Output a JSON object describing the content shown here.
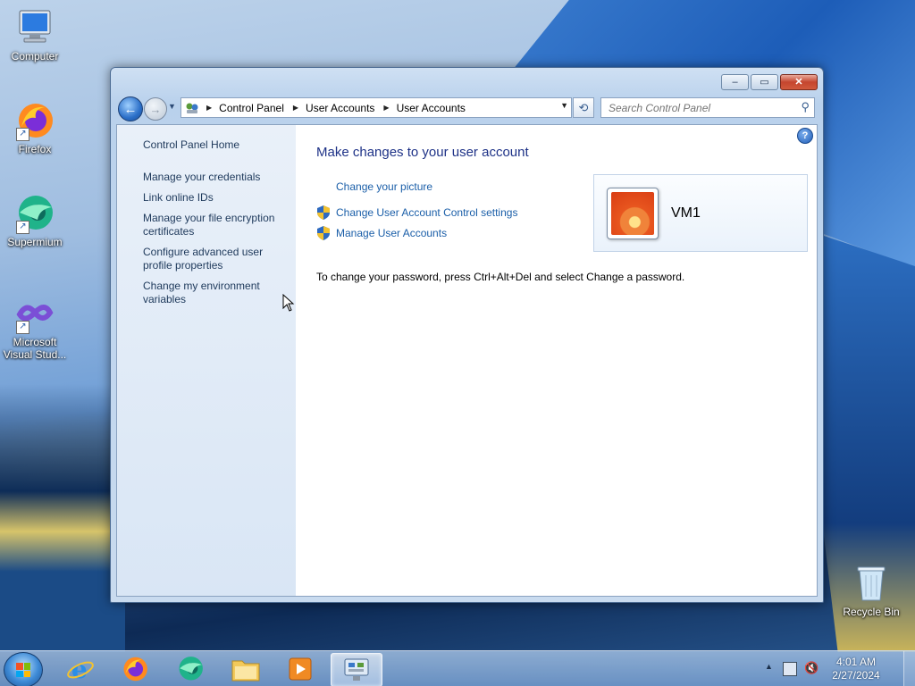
{
  "desktop": {
    "icons": [
      {
        "label": "Computer"
      },
      {
        "label": "Firefox"
      },
      {
        "label": "Supermium"
      },
      {
        "label": "Microsoft Visual Stud..."
      },
      {
        "label": "Recycle Bin"
      }
    ]
  },
  "window": {
    "caption": {
      "minimize": "–",
      "maximize": "▭",
      "close": "✕"
    },
    "breadcrumb": [
      "Control Panel",
      "User Accounts",
      "User Accounts"
    ],
    "search_placeholder": "Search Control Panel"
  },
  "left_pane": {
    "home": "Control Panel Home",
    "tasks": [
      "Manage your credentials",
      "Link online IDs",
      "Manage your file encryption certificates",
      "Configure advanced user profile properties",
      "Change my environment variables"
    ]
  },
  "main": {
    "title": "Make changes to your user account",
    "links": [
      {
        "label": "Change your picture",
        "shield": false
      },
      {
        "label": "Change User Account Control settings",
        "shield": true
      },
      {
        "label": "Manage User Accounts",
        "shield": true
      }
    ],
    "note": "To change your password, press Ctrl+Alt+Del and select Change a password.",
    "user": {
      "name": "VM1"
    }
  },
  "taskbar": {
    "apps": [
      "internet-explorer",
      "firefox",
      "supermium",
      "file-explorer",
      "media-player",
      "control-panel"
    ],
    "active_app": "control-panel",
    "clock": {
      "time": "4:01 AM",
      "date": "2/27/2024"
    }
  },
  "colors": {
    "link": "#1a5ea8",
    "title": "#1e3287",
    "left_pane_text": "#1e395b"
  }
}
